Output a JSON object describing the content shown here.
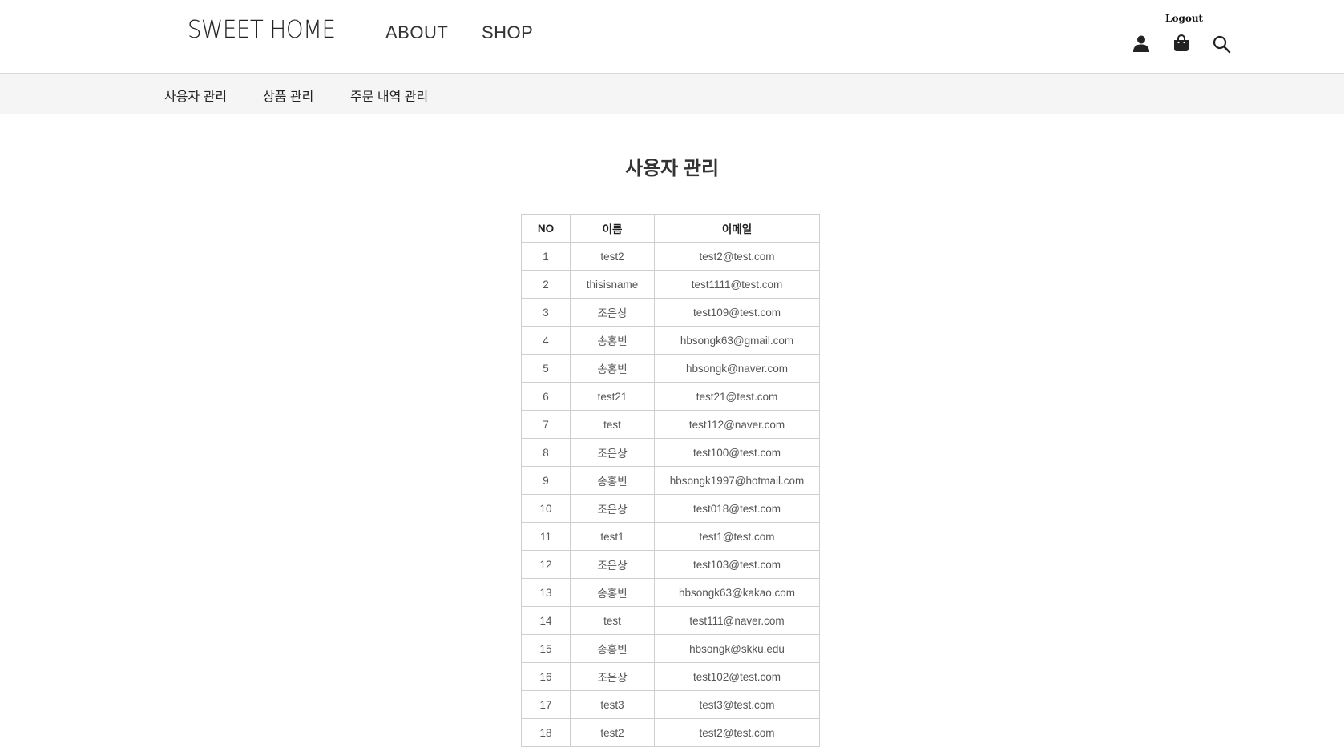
{
  "header": {
    "logo": "SWEET HOME",
    "nav": {
      "about": "ABOUT",
      "shop": "SHOP"
    },
    "logout": "Logout",
    "icons": [
      "user-icon",
      "shopping-bag-icon",
      "search-icon"
    ]
  },
  "subnav": {
    "items": [
      "사용자 관리",
      "상품 관리",
      "주문 내역 관리"
    ]
  },
  "page": {
    "title": "사용자 관리"
  },
  "table": {
    "headers": [
      "NO",
      "이름",
      "이메일"
    ],
    "rows": [
      [
        "1",
        "test2",
        "test2@test.com"
      ],
      [
        "2",
        "thisisname",
        "test1111@test.com"
      ],
      [
        "3",
        "조은상",
        "test109@test.com"
      ],
      [
        "4",
        "송홍빈",
        "hbsongk63@gmail.com"
      ],
      [
        "5",
        "송홍빈",
        "hbsongk@naver.com"
      ],
      [
        "6",
        "test21",
        "test21@test.com"
      ],
      [
        "7",
        "test",
        "test112@naver.com"
      ],
      [
        "8",
        "조은상",
        "test100@test.com"
      ],
      [
        "9",
        "송홍빈",
        "hbsongk1997@hotmail.com"
      ],
      [
        "10",
        "조은상",
        "test018@test.com"
      ],
      [
        "11",
        "test1",
        "test1@test.com"
      ],
      [
        "12",
        "조은상",
        "test103@test.com"
      ],
      [
        "13",
        "송홍빈",
        "hbsongk63@kakao.com"
      ],
      [
        "14",
        "test",
        "test111@naver.com"
      ],
      [
        "15",
        "송홍빈",
        "hbsongk@skku.edu"
      ],
      [
        "16",
        "조은상",
        "test102@test.com"
      ],
      [
        "17",
        "test3",
        "test3@test.com"
      ],
      [
        "18",
        "test2",
        "test2@test.com"
      ]
    ]
  }
}
